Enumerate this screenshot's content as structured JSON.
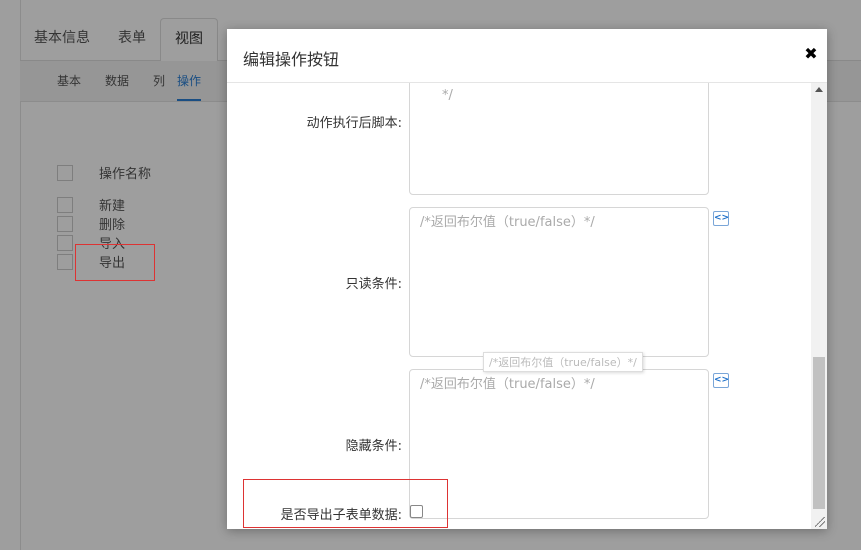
{
  "background": {
    "main_tabs": [
      "基本信息",
      "表单",
      "视图"
    ],
    "active_main_tab": "视图",
    "sub_tabs": [
      "基本",
      "数据",
      "列",
      "操作"
    ],
    "active_sub_tab": "操作",
    "table_header": "操作名称",
    "rows": [
      "新建",
      "删除",
      "导入",
      "导出"
    ]
  },
  "dialog": {
    "title": "编辑操作按钮",
    "close_glyph": "✖",
    "fields": {
      "after_script": {
        "label": "动作执行后脚本:",
        "value": "*/"
      },
      "readonly": {
        "label": "只读条件:",
        "placeholder": "/*返回布尔值（true/false）*/"
      },
      "hidden": {
        "label": "隐藏条件:",
        "placeholder": "/*返回布尔值（true/false）*/"
      },
      "export_subform": {
        "label": "是否导出子表单数据:",
        "checked": false
      }
    },
    "tooltip": "/*返回布尔值（true/false）*/",
    "editor_icon_glyph": "<>"
  },
  "colors": {
    "accent": "#2a7fd4",
    "highlight_box": "#dd3333"
  }
}
